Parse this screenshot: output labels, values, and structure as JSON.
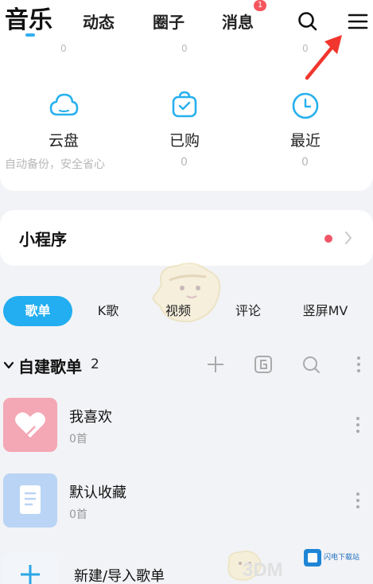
{
  "nav": {
    "tabs": [
      "音乐",
      "动态",
      "圈子",
      "消息"
    ],
    "active": "音乐",
    "message_badge": "1",
    "icons": [
      "search-icon",
      "menu-icon"
    ]
  },
  "stats_row": {
    "values": [
      "0",
      "0",
      "0"
    ]
  },
  "features": [
    {
      "label": "云盘",
      "sub": "自动备份，安全省心",
      "icon": "cloud-icon"
    },
    {
      "label": "已购",
      "sub": "0",
      "icon": "bag-icon"
    },
    {
      "label": "最近",
      "sub": "0",
      "icon": "clock-icon"
    }
  ],
  "mini_program": {
    "title": "小程序"
  },
  "segments": [
    "歌单",
    "K歌",
    "视频",
    "评论",
    "竖屏MV"
  ],
  "playlist_header": {
    "title": "自建歌单",
    "count": "2"
  },
  "playlists": [
    {
      "name": "我喜欢",
      "count": "0首",
      "cover_color": "#f4a7b4",
      "icon": "heart-icon"
    },
    {
      "name": "默认收藏",
      "count": "0首",
      "cover_color": "#b9d4f5",
      "icon": "document-icon"
    }
  ],
  "new_playlist": {
    "label": "新建/导入歌单"
  },
  "watermark": {
    "text": "3DM",
    "logo_text": "闪电下载站"
  },
  "colors": {
    "accent": "#22aef0",
    "badge": "#f5555d",
    "dot": "#ee5565"
  }
}
